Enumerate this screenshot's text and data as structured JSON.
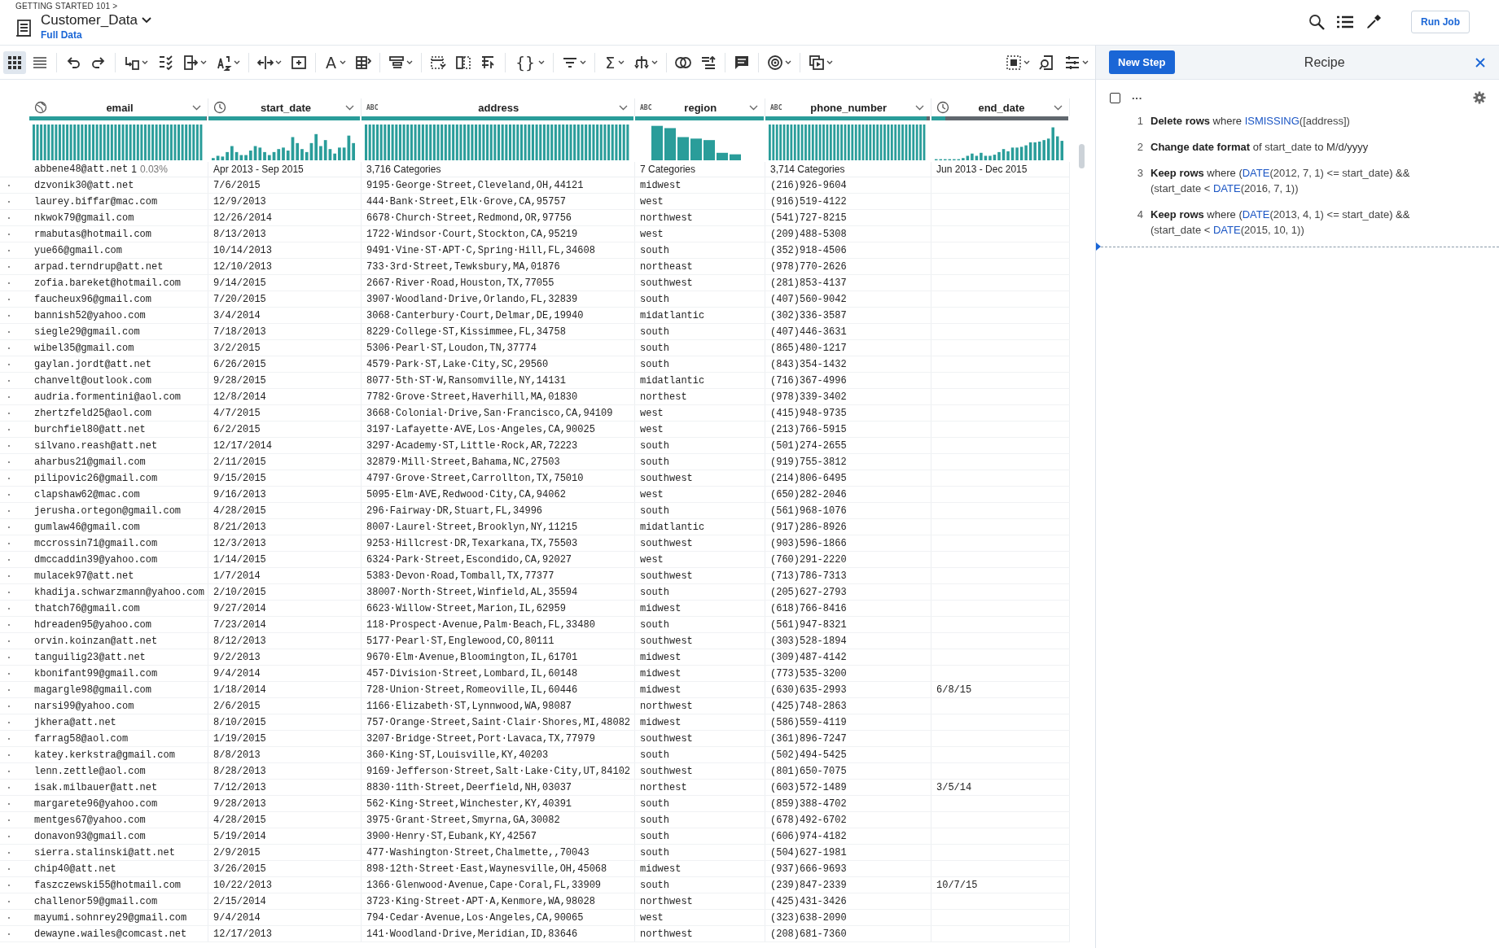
{
  "breadcrumb": "GETTING STARTED 101 >",
  "dataset": {
    "title": "Customer_Data",
    "subtitle": "Full Data"
  },
  "top_actions": {
    "run_button": "Run Job"
  },
  "toolbar": {
    "view_modes": [
      {
        "selected": true
      },
      {
        "selected": false
      }
    ],
    "glyphs": [
      "A",
      "{}",
      "Σ"
    ]
  },
  "table": {
    "columns": [
      {
        "name": "email",
        "kind": "url",
        "level": 0.997,
        "summary": "abbene48@att.net",
        "summary_count": "1",
        "summary_share": "0.03%"
      },
      {
        "name": "start_date",
        "kind": "datetime",
        "level": 1,
        "summary": "Apr 2013 - Sep 2015"
      },
      {
        "name": "address",
        "kind": "string",
        "badge": "ABC",
        "level": 1,
        "summary": "3,716 Categories"
      },
      {
        "name": "region",
        "kind": "string",
        "badge": "ABC",
        "level": 1,
        "summary": "7 Categories"
      },
      {
        "name": "phone_number",
        "kind": "string",
        "badge": "ABC",
        "level": 0.98,
        "summary": "3,714 Categories"
      },
      {
        "name": "end_date",
        "kind": "datetime",
        "level": 0.1,
        "summary": "Jun 2013 - Dec 2015"
      }
    ],
    "rows": [
      [
        "dzvonik30@att.net",
        "7/6/2015",
        "9195·George·Street,Cleveland,OH,44121",
        "midwest",
        "(216)926-9604"
      ],
      [
        "laurey.biffar@mac.com",
        "12/9/2013",
        "444·Bank·Street,Elk·Grove,CA,95757",
        "west",
        "(916)519-4122"
      ],
      [
        "nkwok79@gmail.com",
        "12/26/2014",
        "6678·Church·Street,Redmond,OR,97756",
        "northwest",
        "(541)727-8215"
      ],
      [
        "rmabutas@hotmail.com",
        "8/13/2013",
        "1722·Windsor·Court,Stockton,CA,95219",
        "west",
        "(209)488-5308"
      ],
      [
        "yue66@gmail.com",
        "10/14/2013",
        "9491·Vine·ST·APT·C,Spring·Hill,FL,34608",
        "south",
        "(352)918-4506"
      ],
      [
        "arpad.terndrup@att.net",
        "12/10/2013",
        "733·3rd·Street,Tewksbury,MA,01876",
        "northeast",
        "(978)770-2626"
      ],
      [
        "zofia.bareket@hotmail.com",
        "9/14/2015",
        "2667·River·Road,Houston,TX,77055",
        "southwest",
        "(281)853-4137"
      ],
      [
        "faucheux96@gmail.com",
        "7/20/2015",
        "3907·Woodland·Drive,Orlando,FL,32839",
        "south",
        "(407)560-9042"
      ],
      [
        "bannish52@yahoo.com",
        "3/4/2014",
        "3068·Canterbury·Court,Delmar,DE,19940",
        "midatlantic",
        "(302)336-3587"
      ],
      [
        "siegle29@gmail.com",
        "7/18/2013",
        "8229·College·ST,Kissimmee,FL,34758",
        "south",
        "(407)446-3631"
      ],
      [
        "wibel35@gmail.com",
        "3/2/2015",
        "5306·Pearl·ST,Loudon,TN,37774",
        "south",
        "(865)480-1217"
      ],
      [
        "gaylan.jordt@att.net",
        "6/26/2015",
        "4579·Park·ST,Lake·City,SC,29560",
        "south",
        "(843)354-1432"
      ],
      [
        "chanvelt@outlook.com",
        "9/28/2015",
        "8077·5th·ST·W,Ransomville,NY,14131",
        "midatlantic",
        "(716)367-4996"
      ],
      [
        "audria.formentini@aol.com",
        "12/8/2014",
        "7782·Grove·Street,Haverhill,MA,01830",
        "northest",
        "(978)339-3402"
      ],
      [
        "zhertzfeld25@aol.com",
        "4/7/2015",
        "3668·Colonial·Drive,San·Francisco,CA,94109",
        "west",
        "(415)948-9735"
      ],
      [
        "burchfiel80@att.net",
        "6/2/2015",
        "3197·Lafayette·AVE,Los·Angeles,CA,90025",
        "west",
        "(213)766-5915"
      ],
      [
        "silvano.reash@att.net",
        "12/17/2014",
        "3297·Academy·ST,Little·Rock,AR,72223",
        "south",
        "(501)274-2655"
      ],
      [
        "aharbus21@gmail.com",
        "2/11/2015",
        "32879·Mill·Street,Bahama,NC,27503",
        "south",
        "(919)755-3812"
      ],
      [
        "pilipovic26@gmail.com",
        "9/15/2015",
        "4797·Grove·Street,Carrollton,TX,75010",
        "southwest",
        "(214)806-6495"
      ],
      [
        "clapshaw62@mac.com",
        "9/16/2013",
        "5095·Elm·AVE,Redwood·City,CA,94062",
        "west",
        "(650)282-2046"
      ],
      [
        "jerusha.ortegon@gmail.com",
        "4/28/2015",
        "296·Fairway·DR,Stuart,FL,34996",
        "south",
        "(561)968-1076"
      ],
      [
        "gumlaw46@gmail.com",
        "8/21/2013",
        "8007·Laurel·Street,Brooklyn,NY,11215",
        "midatlantic",
        "(917)286-8926"
      ],
      [
        "mccrossin71@gmail.com",
        "12/3/2013",
        "9253·Hillcrest·DR,Texarkana,TX,75503",
        "southwest",
        "(903)596-1866"
      ],
      [
        "dmccaddin39@yahoo.com",
        "1/14/2015",
        "6324·Park·Street,Escondido,CA,92027",
        "west",
        "(760)291-2220"
      ],
      [
        "mulacek97@att.net",
        "1/7/2014",
        "5383·Devon·Road,Tomball,TX,77377",
        "southwest",
        "(713)786-7313"
      ],
      [
        "khadija.schwarzmann@yahoo.com",
        "2/10/2015",
        "38007·North·Street,Winfield,AL,35594",
        "south",
        "(205)627-2793"
      ],
      [
        "thatch76@gmail.com",
        "9/27/2014",
        "6623·Willow·Street,Marion,IL,62959",
        "midwest",
        "(618)766-8416"
      ],
      [
        "hdreaden95@yahoo.com",
        "7/23/2014",
        "118·Prospect·Avenue,Palm·Beach,FL,33480",
        "south",
        "(561)947-8321"
      ],
      [
        "orvin.koinzan@att.net",
        "8/12/2013",
        "5177·Pearl·ST,Englewood,CO,80111",
        "southwest",
        "(303)528-1894"
      ],
      [
        "tanguilig23@att.net",
        "9/2/2013",
        "9670·Elm·Avenue,Bloomington,IL,61701",
        "midwest",
        "(309)487-4142"
      ],
      [
        "kbonifant99@gmail.com",
        "9/4/2014",
        "457·Division·Street,Lombard,IL,60148",
        "midwest",
        "(773)535-3200"
      ],
      [
        "magargle98@gmail.com",
        "1/18/2014",
        "728·Union·Street,Romeoville,IL,60446",
        "midwest",
        "(630)635-2993",
        "6/8/15"
      ],
      [
        "narsi99@yahoo.com",
        "2/6/2015",
        "1166·Elizabeth·ST,Lynnwood,WA,98087",
        "northwest",
        "(425)748-2863"
      ],
      [
        "jkhera@att.net",
        "8/10/2015",
        "757·Orange·Street,Saint·Clair·Shores,MI,48082",
        "midwest",
        "(586)559-4119"
      ],
      [
        "farrag58@aol.com",
        "1/19/2015",
        "3207·Bridge·Street,Port·Lavaca,TX,77979",
        "southwest",
        "(361)896-7247"
      ],
      [
        "katey.kerkstra@gmail.com",
        "8/8/2013",
        "360·King·ST,Louisville,KY,40203",
        "south",
        "(502)494-5425"
      ],
      [
        "lenn.zettle@aol.com",
        "8/28/2013",
        "9169·Jefferson·Street,Salt·Lake·City,UT,84102",
        "southwest",
        "(801)650-7075"
      ],
      [
        "isak.milbauer@att.net",
        "7/12/2013",
        "8830·11th·Street,Deerfield,NH,03037",
        "northest",
        "(603)572-1489",
        "3/5/14"
      ],
      [
        "margarete96@yahoo.com",
        "9/28/2013",
        "562·King·Street,Winchester,KY,40391",
        "south",
        "(859)388-4702"
      ],
      [
        "mentges67@yahoo.com",
        "4/28/2015",
        "3975·Grant·Street,Smyrna,GA,30082",
        "south",
        "(678)492-6702"
      ],
      [
        "donavon93@gmail.com",
        "5/19/2014",
        "3900·Henry·ST,Eubank,KY,42567",
        "south",
        "(606)974-4182"
      ],
      [
        "sierra.stalinski@att.net",
        "2/9/2015",
        "477·Washington·Street,Chalmette,,70043",
        "south",
        "(504)627-1981"
      ],
      [
        "chip40@att.net",
        "3/26/2015",
        "898·12th·Street·East,Waynesville,OH,45068",
        "midwest",
        "(937)666-9693"
      ],
      [
        "faszczewski55@hotmail.com",
        "10/22/2013",
        "1366·Glenwood·Avenue,Cape·Coral,FL,33909",
        "south",
        "(239)847-2339",
        "10/7/15"
      ],
      [
        "challenor59@gmail.com",
        "2/15/2014",
        "3723·King·Street·APT·A,Kenmore,WA,98028",
        "northwest",
        "(425)431-3426"
      ],
      [
        "mayumi.sohnrey29@gmail.com",
        "9/4/2014",
        "794·Cedar·Avenue,Los·Angeles,CA,90065",
        "west",
        "(323)638-2090"
      ],
      [
        "dewayne.wailes@comcast.net",
        "12/17/2013",
        "141·Woodland·Drive,Meridian,ID,83646",
        "northwest",
        "(208)681-7360"
      ]
    ]
  },
  "recipe": {
    "new_step": "New Step",
    "title": "Recipe",
    "select_all": {
      "checked": false
    },
    "more": "···",
    "steps": [
      {
        "number": "1",
        "lines": [
          [
            {
              "kind": "action",
              "text": "Delete rows"
            },
            {
              "kind": "plain",
              "text": " where "
            },
            {
              "kind": "function",
              "text": "ISMISSING"
            },
            {
              "kind": "column",
              "text": "([address])"
            }
          ]
        ]
      },
      {
        "number": "2",
        "lines": [
          [
            {
              "kind": "action",
              "text": "Change date format"
            },
            {
              "kind": "plain",
              "text": " of "
            },
            {
              "kind": "column",
              "text": "start_date"
            },
            {
              "kind": "plain",
              "text": " to M/d/yyyy"
            }
          ]
        ]
      },
      {
        "number": "3",
        "lines": [
          [
            {
              "kind": "action",
              "text": "Keep rows"
            },
            {
              "kind": "plain",
              "text": " where ("
            },
            {
              "kind": "function",
              "text": "DATE"
            },
            {
              "kind": "column",
              "text": "(2012, 7, 1) <= start_date"
            },
            {
              "kind": "plain",
              "text": ") &&"
            }
          ],
          [
            {
              "kind": "column",
              "text": "(start_date < "
            },
            {
              "kind": "function",
              "text": "DATE"
            },
            {
              "kind": "column",
              "text": "(2016, 7, 1))"
            }
          ]
        ]
      },
      {
        "number": "4",
        "lines": [
          [
            {
              "kind": "action",
              "text": "Keep rows"
            },
            {
              "kind": "plain",
              "text": " where ("
            },
            {
              "kind": "function",
              "text": "DATE"
            },
            {
              "kind": "column",
              "text": "(2013, 4, 1) <= start_date"
            },
            {
              "kind": "plain",
              "text": ") &&"
            }
          ],
          [
            {
              "kind": "column",
              "text": "(start_date < "
            },
            {
              "kind": "function",
              "text": "DATE"
            },
            {
              "kind": "column",
              "text": "(2015, 10, 1))"
            }
          ]
        ]
      }
    ]
  }
}
